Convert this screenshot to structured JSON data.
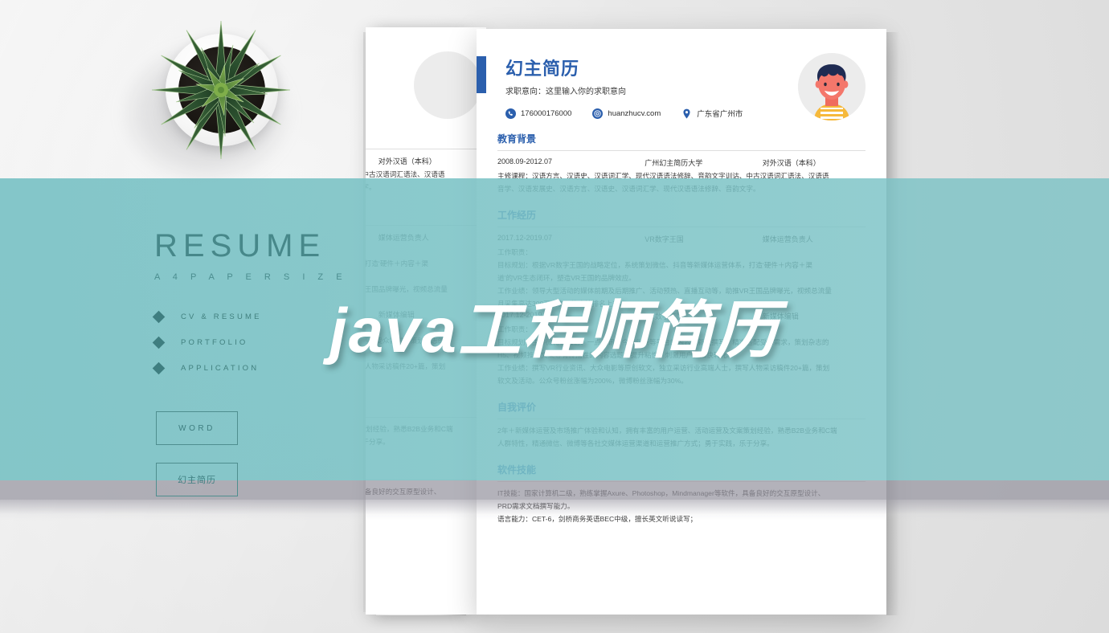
{
  "overlay": {
    "title": "java工程师简历"
  },
  "colors": {
    "teal": "#7AC2C5",
    "blue_accent": "#2B5FAD",
    "band_gray": "#9694A0",
    "page_bg": "#FFFFFF",
    "backdrop": "#ECECEC",
    "marketing_text": "#3F7E80"
  },
  "marketing": {
    "title": "RESUME",
    "subtitle": "A 4   P A P E R   S I Z E",
    "bullets": [
      {
        "label": "CV & RESUME"
      },
      {
        "label": "PORTFOLIO"
      },
      {
        "label": "APPLICATION"
      }
    ],
    "buttons": [
      {
        "label": "WORD"
      },
      {
        "label": "幻主简历"
      }
    ]
  },
  "resume": {
    "name": "幻主简历",
    "intent": "求职意向：这里输入你的求职意向",
    "contacts": [
      {
        "icon": "phone-icon",
        "value": "176000176000"
      },
      {
        "icon": "email-icon",
        "value": "huanzhucv.com"
      },
      {
        "icon": "location-icon",
        "value": "广东省广州市"
      }
    ],
    "sections": [
      {
        "title": "教育背景",
        "entries": [
          {
            "date": "2008.09-2012.07",
            "org": "广州幻主简历大学",
            "role": "对外汉语（本科）",
            "lines": [
              "主修课程：汉语方言、汉语史、汉语词汇学、现代汉语语法修辞、音韵文字训诂、中古汉语词汇语法、汉语语",
              "音学、汉语发展史、汉语方言、汉语史、汉语词汇学、现代汉语语法修辞、音韵文字。"
            ]
          }
        ]
      },
      {
        "title": "工作经历",
        "entries": [
          {
            "date": "2017.12-2019.07",
            "org": "VR数字王国",
            "role": "媒体运营负责人",
            "lines": [
              "工作职责：",
              "目标规划：根据VR数字王国的战略定位，系统策划微信、抖音等新媒体运营体系，打造‘硬件＋内容＋渠",
              "道’的VR生态闭环，塑造VR王国的品牌效应。",
              "工作业绩：领导大型活动的媒体前期及后期推广、活动预热、直播互动等，助推VR王国品牌曝光，视频总流量",
              "月采集高达300万人次，热度榜排名上升。"
            ]
          },
          {
            "date": "2017.12-2019.07",
            "org": "VR数字王国",
            "role": "新媒体编辑",
            "lines": [
              "工作职责：",
              "目标规划：主导微博、微信、一点资讯、今日头条等平台的内容更新及撰写，精准匹配受众需求，策划杂志的",
              "H5、视频推广文案等有传播性的内容选题，提升粘性，刺激用户，加快转化。",
              "工作业绩：撰写VR行业资讯、大众电影等原创软文，独立采访行业高端人士，撰写人物采访稿件20+篇，策划",
              "软文及活动。公众号粉丝涨幅为200%，微博粉丝涨幅为30%。"
            ]
          }
        ]
      },
      {
        "title": "自我评价",
        "entries": [
          {
            "date": "",
            "org": "",
            "role": "",
            "lines": [
              "2年＋新媒体运营及市场推广体验和认知，拥有丰富的用户运营、活动运营及文案策划经验，熟悉B2B业务和C端",
              "人群特性，精通微信、微博等各社交媒体运营渠道和运营推广方式；勇于实践，乐于分享。"
            ]
          }
        ]
      },
      {
        "title": "软件技能",
        "entries": [
          {
            "date": "",
            "org": "",
            "role": "",
            "lines": [
              "IT技能：国家计算机二级，熟练掌握Axure、Photoshop，Mindmanager等软件，具备良好的交互原型设计、",
              "PRD需求文档撰写能力。",
              "语言能力：CET-6，剑桥商务英语BEC中级，擅长英文听说读写；"
            ]
          }
        ]
      }
    ]
  }
}
